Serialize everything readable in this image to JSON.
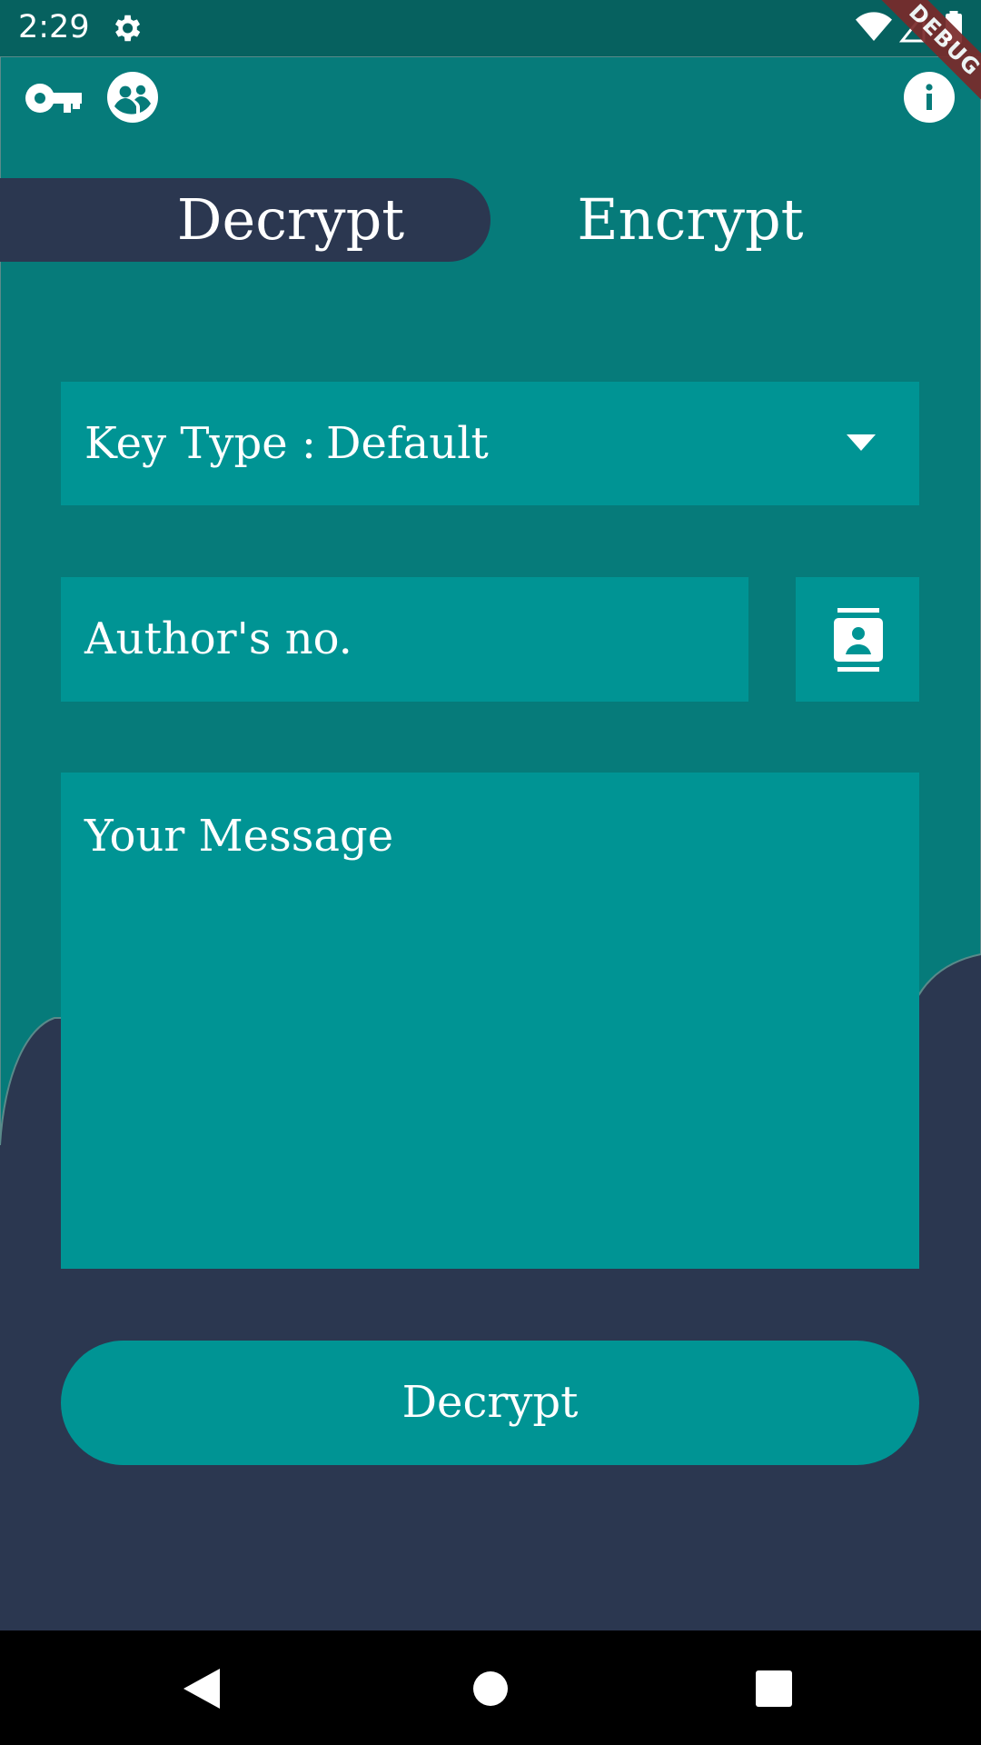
{
  "status_bar": {
    "time": "2:29",
    "debug_label": "DEBUG"
  },
  "tabs": [
    {
      "label": "Decrypt",
      "selected": true
    },
    {
      "label": "Encrypt",
      "selected": false
    }
  ],
  "key_type": {
    "label": "Key Type :",
    "value": "Default"
  },
  "author": {
    "placeholder": "Author's no."
  },
  "message": {
    "placeholder": "Your Message"
  },
  "action_button": {
    "label": "Decrypt"
  },
  "icons": {
    "toolbar_left": [
      "key-icon",
      "group-icon"
    ],
    "toolbar_right": "info-icon",
    "contacts": "contacts-icon"
  },
  "colors": {
    "teal_dark": "#06615f",
    "teal_bg": "#067b7a",
    "teal_field": "#009494",
    "navy": "#2b3750",
    "debug": "#7a2a2a"
  }
}
